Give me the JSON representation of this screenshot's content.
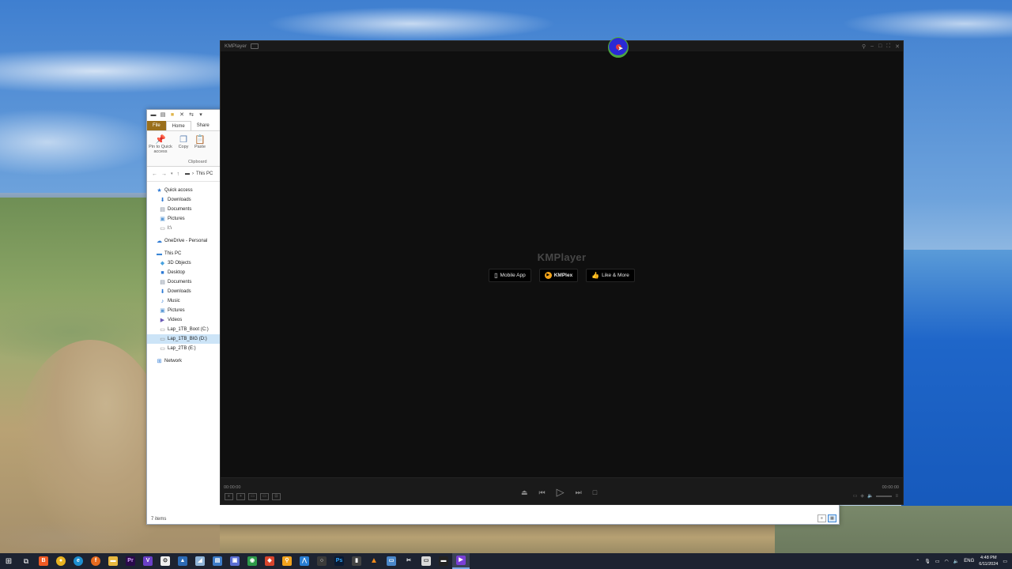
{
  "explorer": {
    "qat_icons": [
      "drive-icon",
      "properties-icon",
      "new-folder-icon",
      "delete-icon",
      "rename-icon",
      "customize-icon"
    ],
    "tabs": {
      "file": "File",
      "home": "Home",
      "share": "Share"
    },
    "ribbon": {
      "pin": "Pin to Quick access",
      "copy": "Copy",
      "paste": "Paste",
      "group": "Clipboard"
    },
    "address": "This PC",
    "nav": {
      "quick_access": "Quick access",
      "downloads": "Downloads",
      "documents": "Documents",
      "pictures": "Pictures",
      "i_drive": "I:\\",
      "onedrive": "OneDrive - Personal",
      "this_pc": "This PC",
      "objects3d": "3D Objects",
      "desktop": "Desktop",
      "documents2": "Documents",
      "downloads2": "Downloads",
      "music": "Music",
      "pictures2": "Pictures",
      "videos": "Videos",
      "drive_c": "Lap_1TB_Boot (C:)",
      "drive_d": "Lap_1TB_BIG (D:)",
      "drive_e": "Lap_2TB (E:)",
      "network": "Network"
    },
    "status": "7 items"
  },
  "kmplayer": {
    "title": "KMPlayer",
    "logo": "KMPlayer",
    "pills": {
      "mobile": "Mobile App",
      "kmplex": "KMPlex",
      "like": "Like & More"
    },
    "time_left": "00:00:00",
    "time_right": "00:00:00"
  },
  "taskbar": {
    "apps": [
      "windows-icon",
      "task-view-icon",
      "brave-icon",
      "chrome-icon",
      "edge-icon",
      "firefox-icon",
      "file-explorer-icon",
      "premiere-icon",
      "visual-studio-icon",
      "terminal-icon",
      "app-icon",
      "app-icon-2",
      "app-icon-3",
      "app-icon-4",
      "app-icon-5",
      "app-icon-6",
      "app-icon-7",
      "app-icon-8",
      "app-icon-9",
      "app-icon-10",
      "photoshop-icon",
      "app-icon-11",
      "vlc-icon",
      "app-icon-12",
      "app-icon-13",
      "app-icon-14",
      "kmplayer-icon"
    ],
    "lang": "ENG",
    "time": "4:48 PM",
    "date": "6/11/2024"
  },
  "colors": {
    "file_tab": "#9a6f1b",
    "kmplayer_bg": "#0f0f0f",
    "taskbar": "#1d2331",
    "kmplex_orange": "#f3a41a"
  }
}
